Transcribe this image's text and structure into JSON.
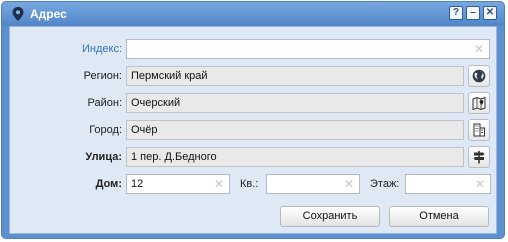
{
  "window": {
    "title": "Адрес",
    "controls": {
      "help": "?",
      "minimize": "–",
      "close": "✕"
    }
  },
  "form": {
    "index": {
      "label": "Индекс:",
      "value": ""
    },
    "region": {
      "label": "Регион:",
      "value": "Пермский край",
      "button_icon": "globe-icon"
    },
    "district": {
      "label": "Район:",
      "value": "Очерский",
      "button_icon": "map-icon"
    },
    "city": {
      "label": "Город:",
      "value": "Очёр",
      "button_icon": "building-icon"
    },
    "street": {
      "label": "Улица:",
      "value": "1 пер. Д.Бедного",
      "button_icon": "signpost-icon"
    },
    "house": {
      "label": "Дом:",
      "value": "12"
    },
    "apartment": {
      "label": "Кв.:",
      "value": ""
    },
    "floor": {
      "label": "Этаж:",
      "value": ""
    },
    "clear_glyph": "✕"
  },
  "buttons": {
    "save": "Сохранить",
    "cancel": "Отмена"
  },
  "colors": {
    "titlebar": "#5c90cf",
    "client_bg": "#dfe8f5",
    "index_label": "#3473b9"
  }
}
